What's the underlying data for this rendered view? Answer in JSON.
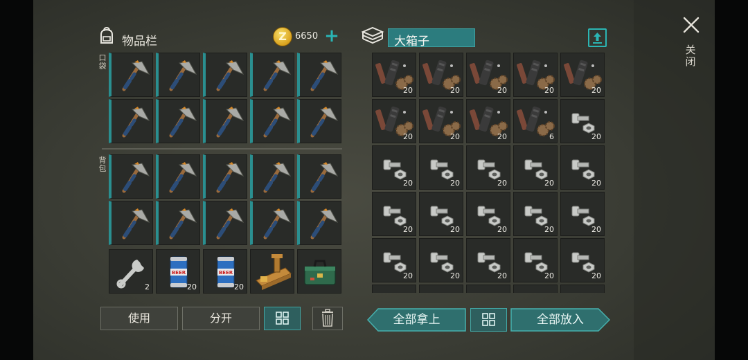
{
  "inventory": {
    "title": "物品栏",
    "money": "6650",
    "pocket_label": "口袋",
    "backpack_label": "背包",
    "extra_slots": [
      {
        "icon": "wrench-icon",
        "qty": "2"
      },
      {
        "icon": "beer-can-icon",
        "qty": "20"
      },
      {
        "icon": "beer-can-icon",
        "qty": "20"
      },
      {
        "icon": "crafting-bench-icon",
        "qty": ""
      },
      {
        "icon": "toolbox-icon",
        "qty": ""
      }
    ],
    "use_label": "使用",
    "split_label": "分开"
  },
  "chest": {
    "title": "大箱子",
    "slots": [
      {
        "icon": "parts-bundle-icon",
        "qty": "20"
      },
      {
        "icon": "parts-bundle-icon",
        "qty": "20"
      },
      {
        "icon": "parts-bundle-icon",
        "qty": "20"
      },
      {
        "icon": "parts-bundle-icon",
        "qty": "20"
      },
      {
        "icon": "parts-bundle-icon",
        "qty": "20"
      },
      {
        "icon": "parts-bundle-icon",
        "qty": "20"
      },
      {
        "icon": "parts-bundle-icon",
        "qty": "20"
      },
      {
        "icon": "parts-bundle-icon",
        "qty": "20"
      },
      {
        "icon": "parts-bundle-icon",
        "qty": "6"
      },
      {
        "icon": "bolt-nut-icon",
        "qty": "20"
      },
      {
        "icon": "bolt-nut-icon",
        "qty": "20"
      },
      {
        "icon": "bolt-nut-icon",
        "qty": "20"
      },
      {
        "icon": "bolt-nut-icon",
        "qty": "20"
      },
      {
        "icon": "bolt-nut-icon",
        "qty": "20"
      },
      {
        "icon": "bolt-nut-icon",
        "qty": "20"
      },
      {
        "icon": "bolt-nut-icon",
        "qty": "20"
      },
      {
        "icon": "bolt-nut-icon",
        "qty": "20"
      },
      {
        "icon": "bolt-nut-icon",
        "qty": "20"
      },
      {
        "icon": "bolt-nut-icon",
        "qty": "20"
      },
      {
        "icon": "bolt-nut-icon",
        "qty": "20"
      },
      {
        "icon": "bolt-nut-icon",
        "qty": "20"
      },
      {
        "icon": "bolt-nut-icon",
        "qty": "20"
      },
      {
        "icon": "bolt-nut-icon",
        "qty": "20"
      },
      {
        "icon": "bolt-nut-icon",
        "qty": "20"
      },
      {
        "icon": "bolt-nut-icon",
        "qty": "20"
      }
    ],
    "take_all_label": "全部拿上",
    "put_all_label": "全部放入"
  },
  "close_label": "关闭",
  "colors": {
    "accent": "#2a8f90",
    "slot": "#292b28",
    "coin": "#e0aa23"
  }
}
